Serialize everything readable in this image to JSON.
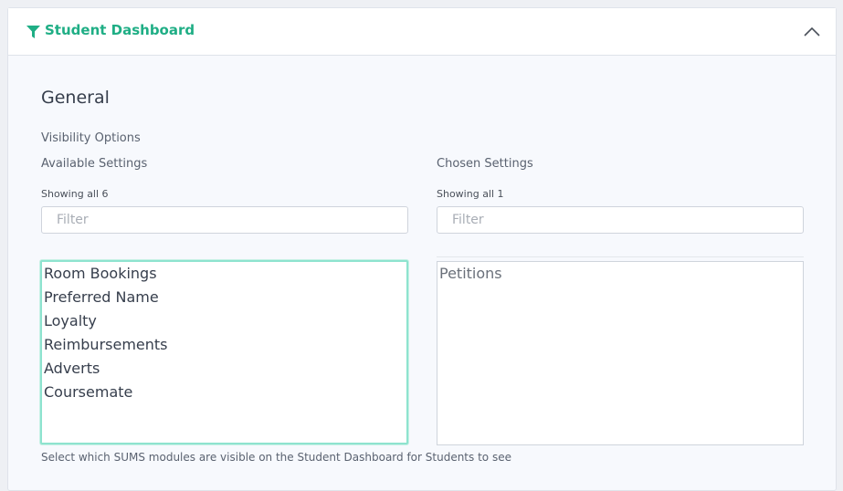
{
  "panel": {
    "title": "Student Dashboard",
    "icon": "filter-icon",
    "collapse_icon": "chevron-up-icon",
    "accent": "#1fae85"
  },
  "section": {
    "title": "General",
    "visibility_label": "Visibility Options"
  },
  "available": {
    "label": "Available Settings",
    "count_text": "Showing all 6",
    "filter_placeholder": "Filter",
    "items": [
      "Room Bookings",
      "Preferred Name",
      "Loyalty",
      "Reimbursements",
      "Adverts",
      "Coursemate"
    ]
  },
  "chosen": {
    "label": "Chosen Settings",
    "count_text": "Showing all 1",
    "filter_placeholder": "Filter",
    "items": [
      "Petitions"
    ]
  },
  "help_text": "Select which SUMS modules are visible on the Student Dashboard for Students to see"
}
